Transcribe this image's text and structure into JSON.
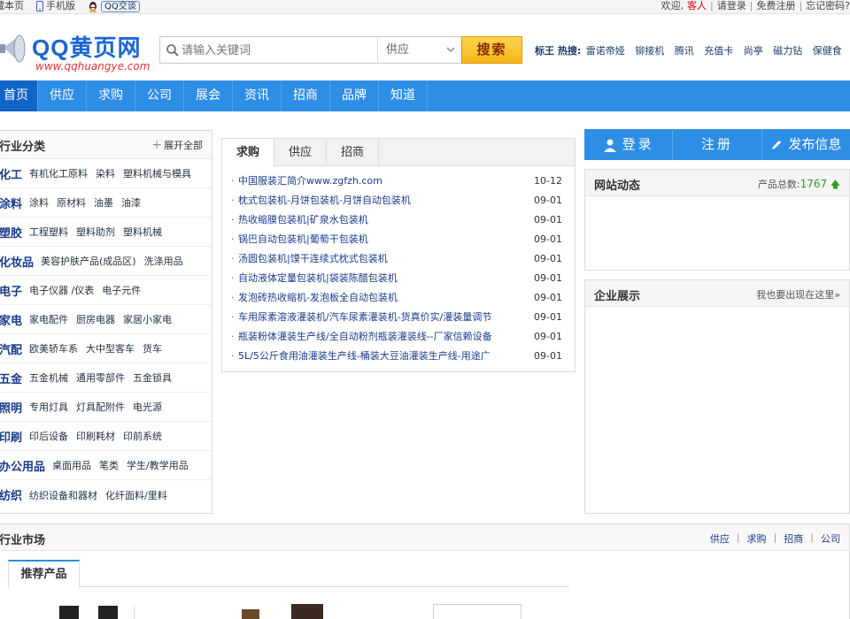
{
  "topbar": {
    "left": {
      "bookmark": "藏本页",
      "mobile": "手机版",
      "qq": "QQ交谈"
    },
    "right": {
      "welcome": "欢迎,",
      "guest": "客人",
      "sep": "|",
      "login": "请登录",
      "register": "免费注册",
      "forgot": "忘记密码?"
    }
  },
  "logo": {
    "title": "QQ黄页网",
    "url": "www.qqhuangye.com"
  },
  "search": {
    "placeholder": "请输入关键词",
    "category": "供应",
    "button": "搜索"
  },
  "hot": {
    "label": "标王 热搜:",
    "items": [
      "雷诺帝娅",
      "铆接机",
      "腾讯",
      "充值卡",
      "尚亭",
      "磁力钻",
      "保健食"
    ]
  },
  "nav": {
    "items": [
      "首页",
      "供应",
      "求购",
      "公司",
      "展会",
      "资讯",
      "招商",
      "品牌",
      "知道"
    ]
  },
  "categories": {
    "title": "行业分类",
    "expand": "展开全部",
    "rows": [
      {
        "main": "化工",
        "subs": [
          "有机化工原料",
          "染料",
          "塑料机械与模具"
        ]
      },
      {
        "main": "涂料",
        "subs": [
          "涂料",
          "原材料",
          "油墨",
          "油漆"
        ]
      },
      {
        "main": "塑胶",
        "subs": [
          "工程塑料",
          "塑料助剂",
          "塑料机械"
        ]
      },
      {
        "main": "化妆品",
        "subs": [
          "美容护肤产品(成品区)",
          "洗涤用品"
        ]
      },
      {
        "main": "电子",
        "subs": [
          "电子仪器 /仪表",
          "电子元件"
        ]
      },
      {
        "main": "家电",
        "subs": [
          "家电配件",
          "厨房电器",
          "家居小家电"
        ]
      },
      {
        "main": "汽配",
        "subs": [
          "欧美轿车系",
          "大中型客车",
          "货车"
        ]
      },
      {
        "main": "五金",
        "subs": [
          "五金机械",
          "通用零部件",
          "五金锁具"
        ]
      },
      {
        "main": "照明",
        "subs": [
          "专用灯具",
          "灯具配附件",
          "电光源"
        ]
      },
      {
        "main": "印刷",
        "subs": [
          "印后设备",
          "印刷耗材",
          "印前系统"
        ]
      },
      {
        "main": "办公用品",
        "subs": [
          "桌面用品",
          "笔类",
          "学生/教学用品"
        ]
      },
      {
        "main": "纺织",
        "subs": [
          "纺织设备和器材",
          "化纤面料/里料"
        ]
      }
    ]
  },
  "mid": {
    "tabs": [
      "求购",
      "供应",
      "招商"
    ],
    "list": [
      {
        "text": "中国服装汇简介www.zgfzh.com",
        "date": "10-12"
      },
      {
        "text": "枕式包装机-月饼包装机-月饼自动包装机",
        "date": "09-01"
      },
      {
        "text": "热收缩膜包装机|矿泉水包装机",
        "date": "09-01"
      },
      {
        "text": "锅巴自动包装机|葡萄干包装机",
        "date": "09-01"
      },
      {
        "text": "汤圆包装机|馍干连续式枕式包装机",
        "date": "09-01"
      },
      {
        "text": "自动液体定量包装机|袋装陈醋包装机",
        "date": "09-01"
      },
      {
        "text": "发泡砖热收缩机-发泡板全自动包装机",
        "date": "09-01"
      },
      {
        "text": "车用尿素溶液灌装机/汽车尿素灌装机-货真价实/灌装量调节",
        "date": "09-01"
      },
      {
        "text": "瓶装粉体灌装生产线/全自动粉剂瓶装灌装线--厂家信赖设备",
        "date": "09-01"
      },
      {
        "text": "5L/5公斤食用油灌装生产线-桶装大豆油灌装生产线-用途广",
        "date": "09-01"
      }
    ]
  },
  "right": {
    "login": "登录",
    "register": "注册",
    "publish": "发布信息",
    "news_title": "网站动态",
    "total_label": "产品总数:",
    "total": "1767",
    "showcase_title": "企业展示",
    "showcase_link": "我也要出现在这里»"
  },
  "market": {
    "title": "行业市场",
    "links": [
      "供应",
      "求购",
      "招商",
      "公司"
    ],
    "tab": "推荐产品"
  },
  "colors": {
    "nav_blue": "#2e8ee6",
    "nav_active": "#1265c6",
    "search_btn": "#f6b717",
    "guest_red": "#dd0000",
    "count_green": "#2b9a2b"
  }
}
